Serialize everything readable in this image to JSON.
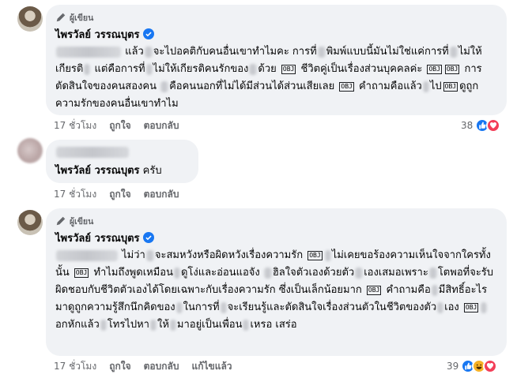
{
  "comments": [
    {
      "badge": "ผู้เขียน",
      "name": "ไพรวัลย์ วรรณบุตร",
      "segments": [
        {
          "t": "blur",
          "w": 82
        },
        {
          "t": "text",
          "v": " แล้ว"
        },
        {
          "t": "blur",
          "w": 10
        },
        {
          "t": "text",
          "v": "จะไปอคติกับคนอื่นเขาทำไมคะ การที่"
        },
        {
          "t": "blur",
          "w": 10
        },
        {
          "t": "text",
          "v": "พิมพ์แบบนี้มันไม่ใช่แค่การที่"
        },
        {
          "t": "blur",
          "w": 10
        },
        {
          "t": "text",
          "v": "ไม่ให้เกียรติ"
        },
        {
          "t": "blur",
          "w": 8
        },
        {
          "t": "text",
          "v": " แต่คือการที่"
        },
        {
          "t": "blur",
          "w": 8
        },
        {
          "t": "text",
          "v": "ไม่ให้เกียรติคนรักของ"
        },
        {
          "t": "blur",
          "w": 10
        },
        {
          "t": "text",
          "v": "ด้วย "
        },
        {
          "t": "obj",
          "v": "OBJ"
        },
        {
          "t": "text",
          "v": " ชีวิตคู่เป็นเรื่องส่วนบุคคลค่ะ "
        },
        {
          "t": "obj",
          "v": "OBJ"
        },
        {
          "t": "obj",
          "v": "OBJ"
        },
        {
          "t": "text",
          "v": " การตัดสินใจของคนสองคน "
        },
        {
          "t": "blur",
          "w": 10
        },
        {
          "t": "text",
          "v": "คือคนนอกที่ไม่ได้มีส่วนได้ส่วนเสียเลย "
        },
        {
          "t": "obj",
          "v": "OBJ"
        },
        {
          "t": "text",
          "v": " คำถามคือแล้ว"
        },
        {
          "t": "blur",
          "w": 8
        },
        {
          "t": "text",
          "v": "ไป"
        },
        {
          "t": "obj",
          "v": "OBJ"
        },
        {
          "t": "text",
          "v": "ดูถูกความรักของคนอื่นเขาทำไม"
        }
      ],
      "time": "17 ชั่วโมง",
      "like_label": "ถูกใจ",
      "reply_label": "ตอบกลับ",
      "reaction_count": "38",
      "reactions": [
        "like-icon",
        "love-icon"
      ]
    },
    {
      "name": "ไพรวัลย์ วรรณบุตร",
      "suffix": " ครับ",
      "time": "17 ชั่วโมง",
      "like_label": "ถูกใจ",
      "reply_label": "ตอบกลับ"
    },
    {
      "badge": "ผู้เขียน",
      "name": "ไพรวัลย์ วรรณบุตร",
      "segments": [
        {
          "t": "blur",
          "w": 78
        },
        {
          "t": "text",
          "v": " ไม่ว่า"
        },
        {
          "t": "blur",
          "w": 10
        },
        {
          "t": "text",
          "v": "จะสมหวังหรือผิดหวังเรื่องความรัก "
        },
        {
          "t": "obj",
          "v": "OBJ"
        },
        {
          "t": "blur",
          "w": 8
        },
        {
          "t": "text",
          "v": "ไม่เคยขอร้องความเห็นใจจากใครทั้งนั้น "
        },
        {
          "t": "obj",
          "v": "OBJ"
        },
        {
          "t": "text",
          "v": " ทำไมถึงพูดเหมือน"
        },
        {
          "t": "blur",
          "w": 8
        },
        {
          "t": "text",
          "v": "ดูโง่และอ่อนแอจัง "
        },
        {
          "t": "blur",
          "w": 10
        },
        {
          "t": "text",
          "v": "ฮิลใจตัวเองด้วยตัว"
        },
        {
          "t": "blur",
          "w": 10
        },
        {
          "t": "text",
          "v": "เองเสมอเพราะ"
        },
        {
          "t": "blur",
          "w": 10
        },
        {
          "t": "text",
          "v": "โตพอที่จะรับผิดชอบกับชีวิตตัวเองได้โดยเฉพาะกับเรื่องความรัก ซึ่งเป็นเล็กน้อยมาก "
        },
        {
          "t": "obj",
          "v": "OBJ"
        },
        {
          "t": "text",
          "v": " คำถามคือ"
        },
        {
          "t": "blur",
          "w": 8
        },
        {
          "t": "text",
          "v": "มีสิทธิ์อะไรมาดูถูกความรู้สึกนึกคิดของ"
        },
        {
          "t": "blur",
          "w": 8
        },
        {
          "t": "text",
          "v": "ในการที่"
        },
        {
          "t": "blur",
          "w": 8
        },
        {
          "t": "text",
          "v": "จะเรียนรู้และตัดสินใจเรื่องส่วนตัวในชีวิตของตัว"
        },
        {
          "t": "blur",
          "w": 8
        },
        {
          "t": "text",
          "v": "เอง "
        },
        {
          "t": "obj",
          "v": "OBJ"
        },
        {
          "t": "blur",
          "w": 8
        },
        {
          "t": "text",
          "v": "อกหักแล้ว"
        },
        {
          "t": "blur",
          "w": 8
        },
        {
          "t": "text",
          "v": "โทรไปหา"
        },
        {
          "t": "blur",
          "w": 8
        },
        {
          "t": "text",
          "v": "ให้"
        },
        {
          "t": "blur",
          "w": 8
        },
        {
          "t": "text",
          "v": "มาอยู่เป็นเพื่อน"
        },
        {
          "t": "blur",
          "w": 8
        },
        {
          "t": "text",
          "v": "เหรอ เสร่อ"
        }
      ],
      "time": "17 ชั่วโมง",
      "like_label": "ถูกใจ",
      "reply_label": "ตอบกลับ",
      "edited_label": "แก้ไขแล้ว",
      "reaction_count": "39",
      "reactions": [
        "like-icon",
        "haha-icon",
        "love-icon"
      ]
    }
  ],
  "colors": {
    "bubble": "#f0f2f5",
    "meta": "#65676b",
    "verified": "#1877f2",
    "like": "#1877f2",
    "love": "#f33e58",
    "haha": "#f7b125"
  }
}
